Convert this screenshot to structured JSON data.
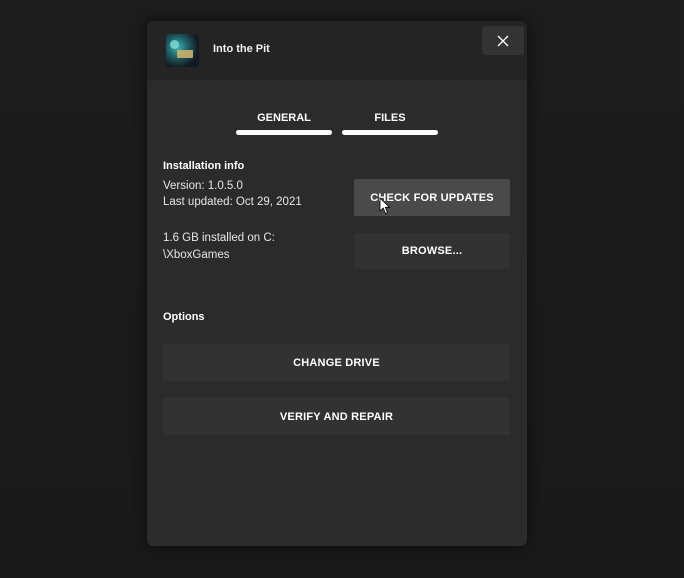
{
  "dialog": {
    "game_title": "Into the Pit",
    "game_thumbnail_icon": "game-cover-icon",
    "close_icon": "close-icon"
  },
  "tabs": [
    {
      "label": "GENERAL",
      "active": true
    },
    {
      "label": "FILES",
      "active": false
    }
  ],
  "installation": {
    "heading": "Installation info",
    "version": "Version: 1.0.5.0",
    "last_updated": "Last updated: Oct 29, 2021",
    "location_line1": "1.6 GB installed on C:",
    "location_line2": "\\XboxGames",
    "check_updates_label": "CHECK FOR UPDATES",
    "browse_label": "BROWSE..."
  },
  "options": {
    "heading": "Options",
    "change_drive_label": "CHANGE DRIVE",
    "verify_repair_label": "VERIFY AND REPAIR"
  },
  "colors": {
    "background": "#1a1a1b",
    "dialog": "#2b2b2c",
    "titlebar": "#242425",
    "button": "#323233",
    "button_hover": "#4a4a4b",
    "text": "#ffffff"
  }
}
